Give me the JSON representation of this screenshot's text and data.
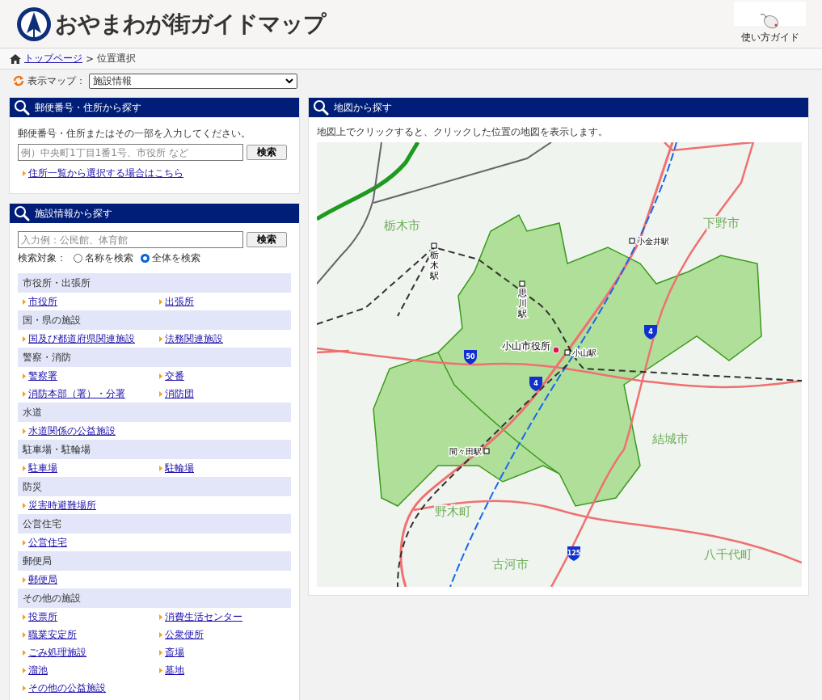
{
  "header": {
    "title": "おやまわが街ガイドマップ",
    "guide_button": "使い方ガイド"
  },
  "breadcrumb": {
    "home_link": "トップページ",
    "separator": ">",
    "current": "位置選択"
  },
  "map_selector": {
    "label": "表示マップ：",
    "value": "施設情報"
  },
  "address_search": {
    "title": "郵便番号・住所から探す",
    "instruction": "郵便番号・住所またはその一部を入力してください。",
    "placeholder": "例）中央町1丁目1番1号、市役所 など",
    "button": "検索",
    "link": "住所一覧から選択する場合はこちら"
  },
  "facility_search": {
    "title": "施設情報から探す",
    "placeholder": "入力例：公民館、体育館",
    "button": "検索",
    "target_label": "検索対象：",
    "radios": [
      {
        "label": "名称を検索",
        "selected": false
      },
      {
        "label": "全体を検索",
        "selected": true
      }
    ],
    "categories": [
      {
        "title": "市役所・出張所",
        "items": [
          "市役所",
          "出張所"
        ]
      },
      {
        "title": "国・県の施設",
        "items": [
          "国及び都道府県関連施設",
          "法務関連施設"
        ]
      },
      {
        "title": "警察・消防",
        "items": [
          "警察署",
          "交番",
          "消防本部（署）・分署",
          "消防団"
        ]
      },
      {
        "title": "水道",
        "items": [
          "水道関係の公益施設"
        ]
      },
      {
        "title": "駐車場・駐輪場",
        "items": [
          "駐車場",
          "駐輪場"
        ]
      },
      {
        "title": "防災",
        "items": [
          "災害時避難場所"
        ]
      },
      {
        "title": "公営住宅",
        "items": [
          "公営住宅"
        ]
      },
      {
        "title": "郵便局",
        "items": [
          "郵便局"
        ]
      },
      {
        "title": "その他の施設",
        "items": [
          "投票所",
          "消費生活センター",
          "職業安定所",
          "公衆便所",
          "ごみ処理施設",
          "斎場",
          "溜池",
          "墓地",
          "その他の公益施設"
        ]
      }
    ]
  },
  "map_search": {
    "title": "地図から探す",
    "instruction": "地図上でクリックすると、クリックした位置の地図を表示します。",
    "map": {
      "area_labels": [
        "栃木市",
        "下野市",
        "結城市",
        "野木町",
        "古河市",
        "八千代町"
      ],
      "station_labels": [
        "栃木駅",
        "思川駅",
        "小金井駅",
        "小山駅",
        "間々田駅"
      ],
      "landmark": "小山市役所",
      "route_labels": [
        "50",
        "4",
        "4",
        "125"
      ]
    }
  }
}
